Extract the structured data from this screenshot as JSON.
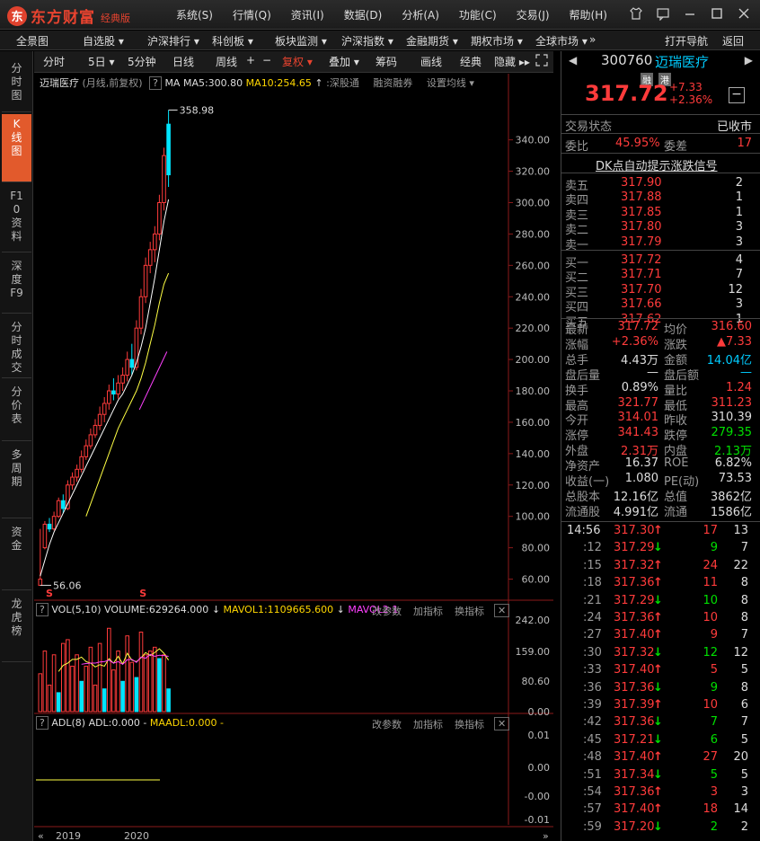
{
  "app": {
    "logo_mark": "东",
    "name": "东方财富",
    "edition": "经典版",
    "menu": [
      "系统(S)",
      "行情(Q)",
      "资讯(I)",
      "数据(D)",
      "分析(A)",
      "功能(C)",
      "交易(J)",
      "帮助(H)"
    ]
  },
  "window_icons": [
    "shirt-icon",
    "message-icon",
    "minimize-icon",
    "maximize-icon",
    "close-icon"
  ],
  "nav": {
    "items": [
      "全景图",
      "自选股 ▾",
      "沪深排行 ▾",
      "科创板 ▾",
      "板块监测 ▾",
      "沪深指数 ▾",
      "金融期货 ▾",
      "期权市场 ▾",
      "全球市场 ▾",
      "»"
    ],
    "right": [
      "打开导航",
      "返回"
    ]
  },
  "sidebar": [
    "分时图",
    "K线图",
    "F10资料",
    "深度F9",
    "分时成交",
    "分价表",
    "多周期",
    "资金",
    "龙虎榜"
  ],
  "toolbar": {
    "items": [
      "分时",
      "5日 ▾",
      "5分钟",
      "日线",
      "周线",
      "+",
      "−",
      "复权 ▾",
      "叠加 ▾",
      "筹码",
      "画线",
      "经典",
      "隐藏 ▸▸"
    ],
    "active": "复权 ▾"
  },
  "kline": {
    "name": "迈瑞医疗",
    "period": "(月线,前复权)",
    "help": "?",
    "ma_label": "MA",
    "ma5": "MA5:300.80",
    "ma10": "MA10:254.65",
    "arrow_up": "↑",
    "extra": ":深股通",
    "margin": "融资融券",
    "setting": "设置均线 ▾",
    "high_label": "358.98",
    "low_label": "56.06",
    "axis": [
      "340.00",
      "320.00",
      "300.00",
      "280.00",
      "260.00",
      "240.00",
      "220.00",
      "200.00",
      "180.00",
      "160.00",
      "140.00",
      "120.00",
      "100.00",
      "80.00",
      "60.00"
    ],
    "markers": [
      "S",
      "S"
    ]
  },
  "vol": {
    "help": "?",
    "label": "VOL(5,10)",
    "volume": "VOLUME:629264.000",
    "down_arrow": "↓",
    "mavol1": "MAVOL1:1109665.600",
    "mavol2": "MAVOL2:1",
    "btn1": "改参数",
    "btn2": "加指标",
    "btn3": "换指标",
    "close": "✕",
    "axis": [
      "242.00",
      "159.00",
      "80.60",
      "0.00"
    ]
  },
  "adl": {
    "help": "?",
    "label": "ADL(8)",
    "adl": "ADL:0.000 -",
    "maadl": "MAADL:0.000 -",
    "btn1": "改参数",
    "btn2": "加指标",
    "btn3": "换指标",
    "close": "✕",
    "axis": [
      "0.01",
      "0.00",
      "-0.00",
      "-0.01"
    ]
  },
  "xaxis": [
    "2019",
    "2020"
  ],
  "chart_data": {
    "type": "candlestick",
    "y_range": [
      50,
      365
    ],
    "candles": [
      [
        56.06,
        60,
        92,
        56.06
      ],
      [
        80,
        95,
        97,
        79
      ],
      [
        95,
        92,
        99,
        90
      ],
      [
        92,
        100,
        103,
        91
      ],
      [
        100,
        110,
        112,
        99
      ],
      [
        110,
        105,
        114,
        102
      ],
      [
        105,
        120,
        123,
        104
      ],
      [
        120,
        125,
        128,
        117
      ],
      [
        125,
        130,
        133,
        122
      ],
      [
        130,
        138,
        142,
        128
      ],
      [
        138,
        145,
        149,
        136
      ],
      [
        145,
        152,
        156,
        143
      ],
      [
        152,
        158,
        162,
        150
      ],
      [
        158,
        165,
        170,
        155
      ],
      [
        165,
        172,
        176,
        160
      ],
      [
        172,
        180,
        184,
        168
      ],
      [
        180,
        178,
        188,
        174
      ],
      [
        178,
        185,
        190,
        175
      ],
      [
        185,
        190,
        195,
        180
      ],
      [
        190,
        200,
        205,
        186
      ],
      [
        200,
        195,
        210,
        190
      ],
      [
        195,
        220,
        225,
        193
      ],
      [
        220,
        240,
        245,
        216
      ],
      [
        240,
        260,
        265,
        236
      ],
      [
        260,
        270,
        275,
        255
      ],
      [
        270,
        280,
        285,
        262
      ],
      [
        280,
        300,
        305,
        276
      ],
      [
        300,
        330,
        335,
        295
      ],
      [
        350,
        317.72,
        358.98,
        310
      ]
    ],
    "ma5": [
      62,
      72,
      82,
      90,
      96,
      102,
      108,
      114,
      120,
      126,
      132,
      138,
      144,
      150,
      156,
      162,
      168,
      174,
      178,
      184,
      190,
      198,
      208,
      220,
      236,
      252,
      270,
      288,
      302
    ],
    "ma10": [
      null,
      null,
      null,
      null,
      null,
      null,
      null,
      null,
      null,
      null,
      100,
      108,
      116,
      124,
      132,
      140,
      148,
      156,
      162,
      168,
      174,
      180,
      188,
      198,
      210,
      222,
      236,
      248,
      255
    ],
    "ma_pink": [
      168,
      205
    ],
    "volumes": [
      100,
      160,
      70,
      150,
      50,
      180,
      190,
      120,
      150,
      80,
      120,
      170,
      70,
      180,
      60,
      220,
      110,
      160,
      80,
      200,
      130,
      90,
      210,
      150,
      160,
      170,
      140,
      150,
      60
    ],
    "volume_colors": [
      "r",
      "r",
      "r",
      "r",
      "g",
      "r",
      "r",
      "r",
      "r",
      "g",
      "r",
      "r",
      "r",
      "r",
      "g",
      "r",
      "r",
      "r",
      "g",
      "r",
      "r",
      "g",
      "r",
      "r",
      "r",
      "r",
      "g",
      "r",
      "g"
    ]
  },
  "quote": {
    "code": "300760",
    "name": "迈瑞医疗",
    "tag1": "融",
    "tag2": "港",
    "price": "317.72",
    "change": "+7.33",
    "pct": "+2.36%",
    "minus": "−",
    "status_label": "交易状态",
    "status": "已收市",
    "wb_label": "委比",
    "wb": "45.95%",
    "wc_label": "委差",
    "wc": "17",
    "dk": "DK点自动提示涨跌信号",
    "asks": [
      {
        "label": "卖五",
        "price": "317.90",
        "vol": "2"
      },
      {
        "label": "卖四",
        "price": "317.88",
        "vol": "1"
      },
      {
        "label": "卖三",
        "price": "317.85",
        "vol": "1"
      },
      {
        "label": "卖二",
        "price": "317.80",
        "vol": "3"
      },
      {
        "label": "卖一",
        "price": "317.79",
        "vol": "3"
      }
    ],
    "bids": [
      {
        "label": "买一",
        "price": "317.72",
        "vol": "4"
      },
      {
        "label": "买二",
        "price": "317.71",
        "vol": "7"
      },
      {
        "label": "买三",
        "price": "317.70",
        "vol": "12"
      },
      {
        "label": "买四",
        "price": "317.66",
        "vol": "3"
      },
      {
        "label": "买五",
        "price": "317.62",
        "vol": "1"
      }
    ],
    "stats": [
      {
        "l1": "最新",
        "v1": "317.72",
        "c1": "red",
        "l2": "均价",
        "v2": "316.60",
        "c2": "red"
      },
      {
        "l1": "涨幅",
        "v1": "+2.36%",
        "c1": "red",
        "l2": "涨跌",
        "v2": "▲7.33",
        "c2": "red"
      },
      {
        "l1": "总手",
        "v1": "4.43万",
        "c1": "white",
        "l2": "金额",
        "v2": "14.04亿",
        "c2": "cyan"
      },
      {
        "l1": "盘后量",
        "v1": "—",
        "c1": "white",
        "l2": "盘后额",
        "v2": "—",
        "c2": "cyan"
      },
      {
        "l1": "换手",
        "v1": "0.89%",
        "c1": "white",
        "l2": "量比",
        "v2": "1.24",
        "c2": "red"
      },
      {
        "l1": "最高",
        "v1": "321.77",
        "c1": "red",
        "l2": "最低",
        "v2": "311.23",
        "c2": "red"
      },
      {
        "l1": "今开",
        "v1": "314.01",
        "c1": "red",
        "l2": "昨收",
        "v2": "310.39",
        "c2": "white"
      },
      {
        "l1": "涨停",
        "v1": "341.43",
        "c1": "red",
        "l2": "跌停",
        "v2": "279.35",
        "c2": "green"
      },
      {
        "l1": "外盘",
        "v1": "2.31万",
        "c1": "red",
        "l2": "内盘",
        "v2": "2.13万",
        "c2": "green"
      },
      {
        "l1": "净资产",
        "v1": "16.37",
        "c1": "white",
        "l2": "ROE",
        "v2": "6.82%",
        "c2": "white"
      },
      {
        "l1": "收益(一)",
        "v1": "1.080",
        "c1": "white",
        "l2": "PE(动)",
        "v2": "73.53",
        "c2": "white"
      },
      {
        "l1": "总股本",
        "v1": "12.16亿",
        "c1": "white",
        "l2": "总值",
        "v2": "3862亿",
        "c2": "white"
      },
      {
        "l1": "流通股",
        "v1": "4.991亿",
        "c1": "white",
        "l2": "流通",
        "v2": "1586亿",
        "c2": "white"
      }
    ],
    "ticks": [
      {
        "t": "14:56",
        "p": "317.30",
        "d": "↑",
        "v": "17",
        "n": "13",
        "dc": "red"
      },
      {
        "t": ":12",
        "p": "317.29",
        "d": "↓",
        "v": "9",
        "n": "7",
        "dc": "green"
      },
      {
        "t": ":15",
        "p": "317.32",
        "d": "↑",
        "v": "24",
        "n": "22",
        "dc": "red"
      },
      {
        "t": ":18",
        "p": "317.36",
        "d": "↑",
        "v": "11",
        "n": "8",
        "dc": "red"
      },
      {
        "t": ":21",
        "p": "317.29",
        "d": "↓",
        "v": "10",
        "n": "8",
        "dc": "green"
      },
      {
        "t": ":24",
        "p": "317.36",
        "d": "↑",
        "v": "10",
        "n": "8",
        "dc": "red"
      },
      {
        "t": ":27",
        "p": "317.40",
        "d": "↑",
        "v": "9",
        "n": "7",
        "dc": "red"
      },
      {
        "t": ":30",
        "p": "317.32",
        "d": "↓",
        "v": "12",
        "n": "12",
        "dc": "green"
      },
      {
        "t": ":33",
        "p": "317.40",
        "d": "↑",
        "v": "5",
        "n": "5",
        "dc": "red"
      },
      {
        "t": ":36",
        "p": "317.36",
        "d": "↓",
        "v": "9",
        "n": "8",
        "dc": "green"
      },
      {
        "t": ":39",
        "p": "317.39",
        "d": "↑",
        "v": "10",
        "n": "6",
        "dc": "red"
      },
      {
        "t": ":42",
        "p": "317.36",
        "d": "↓",
        "v": "7",
        "n": "7",
        "dc": "green"
      },
      {
        "t": ":45",
        "p": "317.21",
        "d": "↓",
        "v": "6",
        "n": "5",
        "dc": "green"
      },
      {
        "t": ":48",
        "p": "317.40",
        "d": "↑",
        "v": "27",
        "n": "20",
        "dc": "red"
      },
      {
        "t": ":51",
        "p": "317.34",
        "d": "↓",
        "v": "5",
        "n": "5",
        "dc": "green"
      },
      {
        "t": ":54",
        "p": "317.36",
        "d": "↑",
        "v": "3",
        "n": "3",
        "dc": "red"
      },
      {
        "t": ":57",
        "p": "317.40",
        "d": "↑",
        "v": "18",
        "n": "14",
        "dc": "red"
      },
      {
        "t": ":59",
        "p": "317.20",
        "d": "↓",
        "v": "2",
        "n": "2",
        "dc": "green"
      }
    ]
  }
}
